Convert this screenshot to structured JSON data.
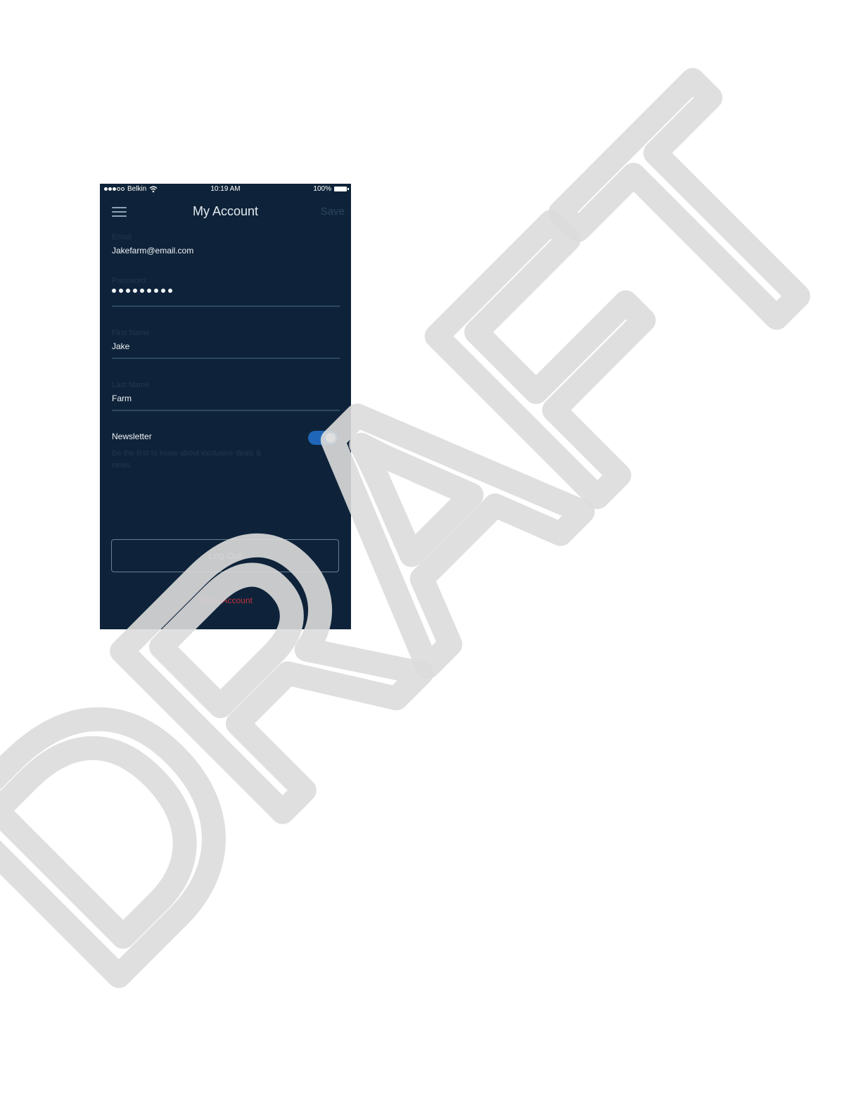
{
  "status_bar": {
    "carrier": "Belkin",
    "time": "10:19 AM",
    "battery": "100%",
    "signal_icon": "signal-dots-icon",
    "wifi_icon": "wifi-icon",
    "battery_icon": "battery-icon"
  },
  "nav": {
    "menu_icon": "hamburger-menu-icon",
    "title": "My Account",
    "save_label": "Save"
  },
  "form": {
    "email": {
      "label": "Email",
      "value": "Jakefarm@email.com"
    },
    "password": {
      "label": "Password",
      "masked_length": 9
    },
    "first_name": {
      "label": "First Name",
      "value": "Jake"
    },
    "last_name": {
      "label": "Last Name",
      "value": "Farm"
    }
  },
  "newsletter": {
    "title": "Newsletter",
    "description": "Be the first to know about exclusive deals & news",
    "enabled": true
  },
  "actions": {
    "logout_label": "Log Out",
    "close_account_label": "Close Account"
  },
  "watermark": {
    "text": "DRAFT"
  },
  "colors": {
    "background": "#0e2339",
    "toggle_on": "#1f66b8",
    "danger": "#c0323c",
    "watermark": "#e0e0e0"
  }
}
